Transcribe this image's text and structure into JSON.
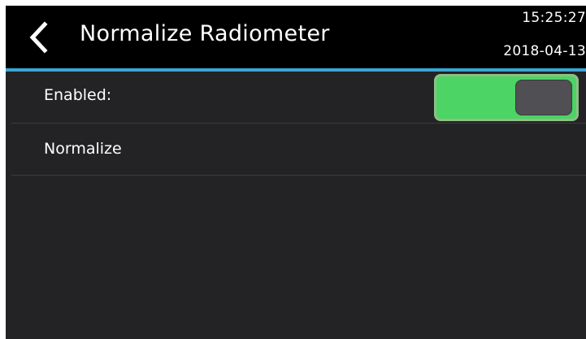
{
  "header": {
    "title": "Normalize Radiometer",
    "time": "15:25:27",
    "date": "2018-04-13",
    "back_icon": "chevron-left-icon"
  },
  "settings": {
    "enabled": {
      "label": "Enabled:",
      "value": true,
      "on_color": "#4cd464"
    },
    "normalize": {
      "label": "Normalize"
    }
  },
  "colors": {
    "background": "#232326",
    "header": "#000000",
    "accent": "#3aa7d3"
  }
}
